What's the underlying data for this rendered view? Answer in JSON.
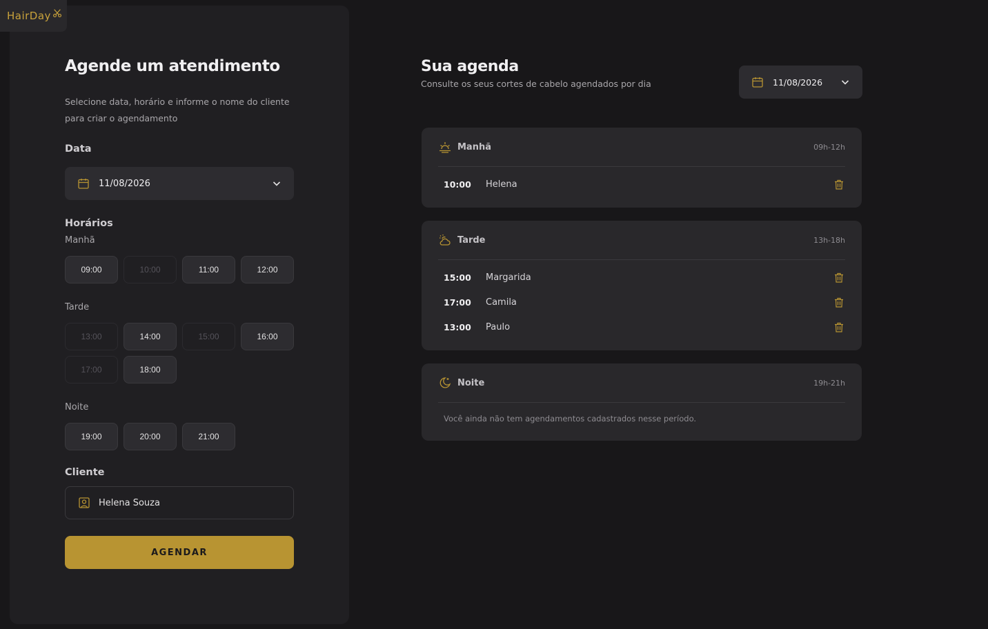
{
  "brand": {
    "name": "HairDay",
    "accent": "#c9a23b"
  },
  "form": {
    "title": "Agende um atendimento",
    "description": "Selecione data, horário e informe o nome do cliente para criar o agendamento",
    "date_label": "Data",
    "date_value": "11/08/2026",
    "hours_label": "Horários",
    "morning_label": "Manhã",
    "morning_slots": [
      {
        "time": "09:00",
        "available": true
      },
      {
        "time": "10:00",
        "available": false
      },
      {
        "time": "11:00",
        "available": true
      },
      {
        "time": "12:00",
        "available": true
      }
    ],
    "afternoon_label": "Tarde",
    "afternoon_slots": [
      {
        "time": "13:00",
        "available": false
      },
      {
        "time": "14:00",
        "available": true
      },
      {
        "time": "15:00",
        "available": false
      },
      {
        "time": "16:00",
        "available": true
      },
      {
        "time": "17:00",
        "available": false
      },
      {
        "time": "18:00",
        "available": true
      }
    ],
    "night_label": "Noite",
    "night_slots": [
      {
        "time": "19:00",
        "available": true
      },
      {
        "time": "20:00",
        "available": true
      },
      {
        "time": "21:00",
        "available": true
      }
    ],
    "client_label": "Cliente",
    "client_value": "Helena Souza",
    "submit_label": "AGENDAR"
  },
  "agenda": {
    "title": "Sua agenda",
    "subtitle": "Consulte os seus cortes de cabelo agendados por dia",
    "date_value": "11/08/2026",
    "periods": [
      {
        "name": "Manhã",
        "range": "09h-12h",
        "icon": "sunrise-icon",
        "appointments": [
          {
            "time": "10:00",
            "client": "Helena"
          }
        ]
      },
      {
        "name": "Tarde",
        "range": "13h-18h",
        "icon": "cloud-sun-icon",
        "appointments": [
          {
            "time": "15:00",
            "client": "Margarida"
          },
          {
            "time": "17:00",
            "client": "Camila"
          },
          {
            "time": "13:00",
            "client": "Paulo"
          }
        ]
      },
      {
        "name": "Noite",
        "range": "19h-21h",
        "icon": "moon-stars-icon",
        "appointments": [],
        "empty_message": "Você ainda não tem agendamentos cadastrados nesse período."
      }
    ]
  }
}
